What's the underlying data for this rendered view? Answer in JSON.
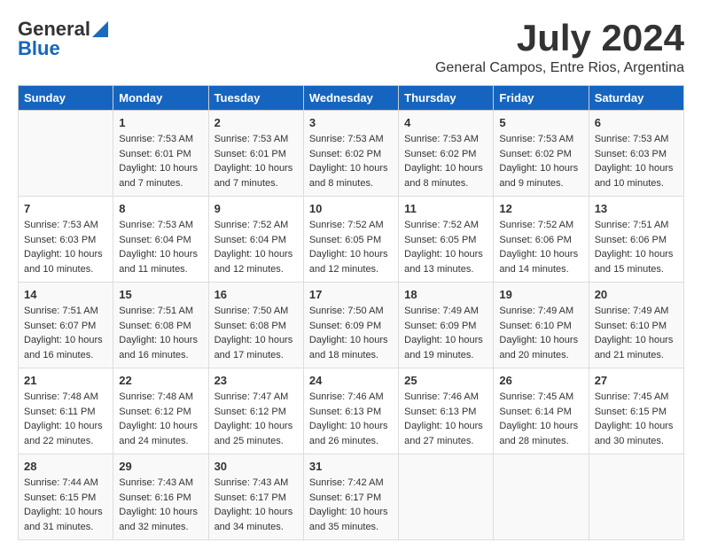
{
  "header": {
    "logo_general": "General",
    "logo_blue": "Blue",
    "month_year": "July 2024",
    "location": "General Campos, Entre Rios, Argentina"
  },
  "days_of_week": [
    "Sunday",
    "Monday",
    "Tuesday",
    "Wednesday",
    "Thursday",
    "Friday",
    "Saturday"
  ],
  "weeks": [
    [
      {
        "day": "",
        "sunrise": "",
        "sunset": "",
        "daylight": ""
      },
      {
        "day": "1",
        "sunrise": "Sunrise: 7:53 AM",
        "sunset": "Sunset: 6:01 PM",
        "daylight": "Daylight: 10 hours and 7 minutes."
      },
      {
        "day": "2",
        "sunrise": "Sunrise: 7:53 AM",
        "sunset": "Sunset: 6:01 PM",
        "daylight": "Daylight: 10 hours and 7 minutes."
      },
      {
        "day": "3",
        "sunrise": "Sunrise: 7:53 AM",
        "sunset": "Sunset: 6:02 PM",
        "daylight": "Daylight: 10 hours and 8 minutes."
      },
      {
        "day": "4",
        "sunrise": "Sunrise: 7:53 AM",
        "sunset": "Sunset: 6:02 PM",
        "daylight": "Daylight: 10 hours and 8 minutes."
      },
      {
        "day": "5",
        "sunrise": "Sunrise: 7:53 AM",
        "sunset": "Sunset: 6:02 PM",
        "daylight": "Daylight: 10 hours and 9 minutes."
      },
      {
        "day": "6",
        "sunrise": "Sunrise: 7:53 AM",
        "sunset": "Sunset: 6:03 PM",
        "daylight": "Daylight: 10 hours and 10 minutes."
      }
    ],
    [
      {
        "day": "7",
        "sunrise": "Sunrise: 7:53 AM",
        "sunset": "Sunset: 6:03 PM",
        "daylight": "Daylight: 10 hours and 10 minutes."
      },
      {
        "day": "8",
        "sunrise": "Sunrise: 7:53 AM",
        "sunset": "Sunset: 6:04 PM",
        "daylight": "Daylight: 10 hours and 11 minutes."
      },
      {
        "day": "9",
        "sunrise": "Sunrise: 7:52 AM",
        "sunset": "Sunset: 6:04 PM",
        "daylight": "Daylight: 10 hours and 12 minutes."
      },
      {
        "day": "10",
        "sunrise": "Sunrise: 7:52 AM",
        "sunset": "Sunset: 6:05 PM",
        "daylight": "Daylight: 10 hours and 12 minutes."
      },
      {
        "day": "11",
        "sunrise": "Sunrise: 7:52 AM",
        "sunset": "Sunset: 6:05 PM",
        "daylight": "Daylight: 10 hours and 13 minutes."
      },
      {
        "day": "12",
        "sunrise": "Sunrise: 7:52 AM",
        "sunset": "Sunset: 6:06 PM",
        "daylight": "Daylight: 10 hours and 14 minutes."
      },
      {
        "day": "13",
        "sunrise": "Sunrise: 7:51 AM",
        "sunset": "Sunset: 6:06 PM",
        "daylight": "Daylight: 10 hours and 15 minutes."
      }
    ],
    [
      {
        "day": "14",
        "sunrise": "Sunrise: 7:51 AM",
        "sunset": "Sunset: 6:07 PM",
        "daylight": "Daylight: 10 hours and 16 minutes."
      },
      {
        "day": "15",
        "sunrise": "Sunrise: 7:51 AM",
        "sunset": "Sunset: 6:08 PM",
        "daylight": "Daylight: 10 hours and 16 minutes."
      },
      {
        "day": "16",
        "sunrise": "Sunrise: 7:50 AM",
        "sunset": "Sunset: 6:08 PM",
        "daylight": "Daylight: 10 hours and 17 minutes."
      },
      {
        "day": "17",
        "sunrise": "Sunrise: 7:50 AM",
        "sunset": "Sunset: 6:09 PM",
        "daylight": "Daylight: 10 hours and 18 minutes."
      },
      {
        "day": "18",
        "sunrise": "Sunrise: 7:49 AM",
        "sunset": "Sunset: 6:09 PM",
        "daylight": "Daylight: 10 hours and 19 minutes."
      },
      {
        "day": "19",
        "sunrise": "Sunrise: 7:49 AM",
        "sunset": "Sunset: 6:10 PM",
        "daylight": "Daylight: 10 hours and 20 minutes."
      },
      {
        "day": "20",
        "sunrise": "Sunrise: 7:49 AM",
        "sunset": "Sunset: 6:10 PM",
        "daylight": "Daylight: 10 hours and 21 minutes."
      }
    ],
    [
      {
        "day": "21",
        "sunrise": "Sunrise: 7:48 AM",
        "sunset": "Sunset: 6:11 PM",
        "daylight": "Daylight: 10 hours and 22 minutes."
      },
      {
        "day": "22",
        "sunrise": "Sunrise: 7:48 AM",
        "sunset": "Sunset: 6:12 PM",
        "daylight": "Daylight: 10 hours and 24 minutes."
      },
      {
        "day": "23",
        "sunrise": "Sunrise: 7:47 AM",
        "sunset": "Sunset: 6:12 PM",
        "daylight": "Daylight: 10 hours and 25 minutes."
      },
      {
        "day": "24",
        "sunrise": "Sunrise: 7:46 AM",
        "sunset": "Sunset: 6:13 PM",
        "daylight": "Daylight: 10 hours and 26 minutes."
      },
      {
        "day": "25",
        "sunrise": "Sunrise: 7:46 AM",
        "sunset": "Sunset: 6:13 PM",
        "daylight": "Daylight: 10 hours and 27 minutes."
      },
      {
        "day": "26",
        "sunrise": "Sunrise: 7:45 AM",
        "sunset": "Sunset: 6:14 PM",
        "daylight": "Daylight: 10 hours and 28 minutes."
      },
      {
        "day": "27",
        "sunrise": "Sunrise: 7:45 AM",
        "sunset": "Sunset: 6:15 PM",
        "daylight": "Daylight: 10 hours and 30 minutes."
      }
    ],
    [
      {
        "day": "28",
        "sunrise": "Sunrise: 7:44 AM",
        "sunset": "Sunset: 6:15 PM",
        "daylight": "Daylight: 10 hours and 31 minutes."
      },
      {
        "day": "29",
        "sunrise": "Sunrise: 7:43 AM",
        "sunset": "Sunset: 6:16 PM",
        "daylight": "Daylight: 10 hours and 32 minutes."
      },
      {
        "day": "30",
        "sunrise": "Sunrise: 7:43 AM",
        "sunset": "Sunset: 6:17 PM",
        "daylight": "Daylight: 10 hours and 34 minutes."
      },
      {
        "day": "31",
        "sunrise": "Sunrise: 7:42 AM",
        "sunset": "Sunset: 6:17 PM",
        "daylight": "Daylight: 10 hours and 35 minutes."
      },
      {
        "day": "",
        "sunrise": "",
        "sunset": "",
        "daylight": ""
      },
      {
        "day": "",
        "sunrise": "",
        "sunset": "",
        "daylight": ""
      },
      {
        "day": "",
        "sunrise": "",
        "sunset": "",
        "daylight": ""
      }
    ]
  ]
}
